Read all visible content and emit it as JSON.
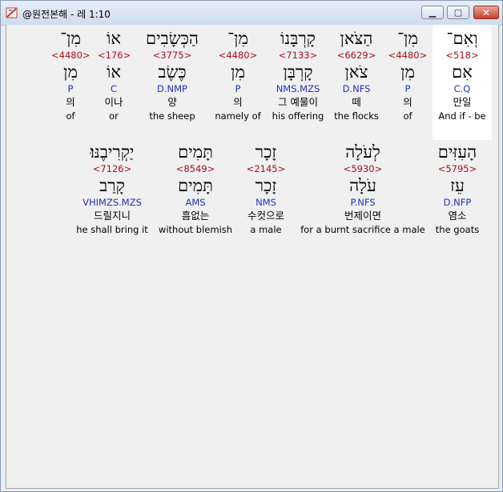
{
  "window": {
    "title": "@원전본해 - 레 1:10",
    "buttons": {
      "minimize": "▁",
      "maximize": "▢",
      "close": "✕"
    }
  },
  "verse": {
    "line1": [
      {
        "heb": "וְאִם־",
        "strong": "<518>",
        "lemma": "אִם",
        "morph": "C.Q",
        "kor": "만일",
        "eng": "And if - be",
        "highlight": true
      },
      {
        "heb": "מִן־",
        "strong": "<4480>",
        "lemma": "מִן",
        "morph": "P",
        "kor": "의",
        "eng": "of"
      },
      {
        "heb": "הַצֹּאן",
        "strong": "<6629>",
        "lemma": "צֹאן",
        "morph": "D.NFS",
        "kor": "떼",
        "eng": "the flocks"
      },
      {
        "heb": "קָרְבָּנוֹ",
        "strong": "<7133>",
        "lemma": "קָרְבָּן",
        "morph": "NMS.MZS",
        "kor": "그 예물이",
        "eng": "his offering"
      },
      {
        "heb": "מִן־",
        "strong": "<4480>",
        "lemma": "מִן",
        "morph": "P",
        "kor": "의",
        "eng": "namely of"
      },
      {
        "heb": "הַכְּשָׂבִים",
        "strong": "<3775>",
        "lemma": "כֶּשֶׂב",
        "morph": "D.NMP",
        "kor": "양",
        "eng": "the sheep"
      },
      {
        "heb": "אוֹ",
        "strong": "<176>",
        "lemma": "אוֹ",
        "morph": "C",
        "kor": "이나",
        "eng": "or"
      },
      {
        "heb": "מִן־",
        "strong": "<4480>",
        "lemma": "מִן",
        "morph": "P",
        "kor": "의",
        "eng": "of"
      }
    ],
    "line2": [
      {
        "heb": "הָעִזִּים",
        "strong": "<5795>",
        "lemma": "עֵז",
        "morph": "D.NFP",
        "kor": "염소",
        "eng": "the goats"
      },
      {
        "heb": "לְעֹלָה",
        "strong": "<5930>",
        "lemma": "עֹלָה",
        "morph": "P.NFS",
        "kor": "번제이면",
        "eng": "for a burnt sacrifice a male"
      },
      {
        "heb": "זָכָר",
        "strong": "<2145>",
        "lemma": "זָכָר",
        "morph": "NMS",
        "kor": "수컷으로",
        "eng": "a male"
      },
      {
        "heb": "תָּמִים",
        "strong": "<8549>",
        "lemma": "תָּמִים",
        "morph": "AMS",
        "kor": "흠없는",
        "eng": "without blemish"
      },
      {
        "heb": "יַקְרִיבֶנּוּ׃",
        "strong": "<7126>",
        "lemma": "קָרַב",
        "morph": "VHIMZS.MZS",
        "kor": "드릴지니",
        "eng": "he shall bring it"
      }
    ]
  },
  "colors": {
    "strong": "#a8101a",
    "morph": "#1f2fbf",
    "text": "#000000",
    "background": "#f0f0f0"
  }
}
